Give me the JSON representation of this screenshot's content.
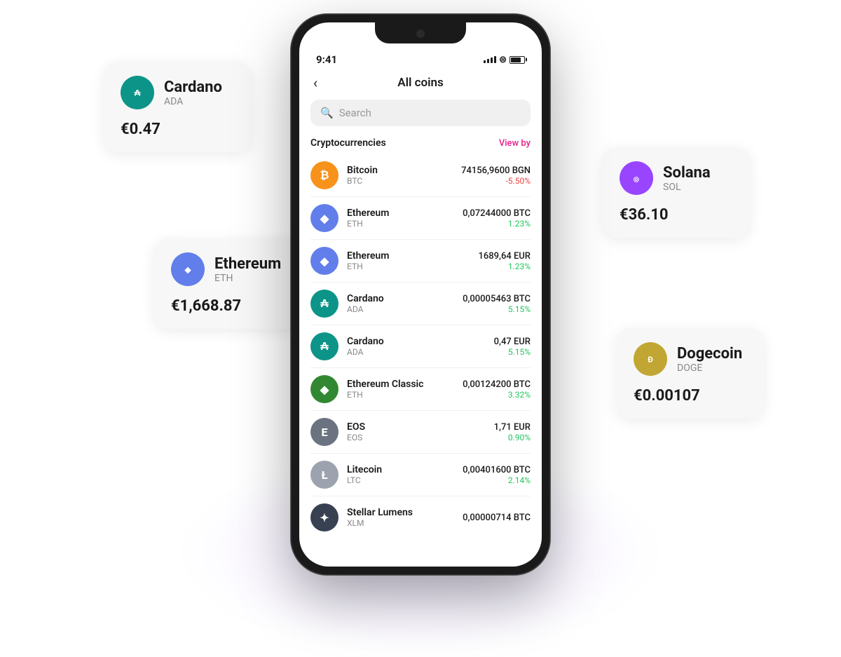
{
  "scene": {
    "background": "#ffffff"
  },
  "cards": {
    "cardano": {
      "name": "Cardano",
      "symbol": "ADA",
      "price": "€0.47"
    },
    "ethereum": {
      "name": "Ethereum",
      "symbol": "ETH",
      "price": "€1,668.87"
    },
    "solana": {
      "name": "Solana",
      "symbol": "SOL",
      "price": "€36.10"
    },
    "dogecoin": {
      "name": "Dogecoin",
      "symbol": "DOGE",
      "price": "€0.00107"
    }
  },
  "phone": {
    "status": {
      "time": "9:41"
    },
    "header": {
      "title": "All coins",
      "back": "‹"
    },
    "search": {
      "placeholder": "Search"
    },
    "section": {
      "title": "Cryptocurrencies",
      "view_by": "View by"
    },
    "coins": [
      {
        "name": "Bitcoin",
        "symbol": "BTC",
        "amount": "74156,9600 BGN",
        "change": "-5.50%",
        "positive": false,
        "iconClass": "icon-btc",
        "iconText": "₿"
      },
      {
        "name": "Ethereum",
        "symbol": "ETH",
        "amount": "0,07244000 BTC",
        "change": "1.23%",
        "positive": true,
        "iconClass": "icon-eth",
        "iconText": "◆"
      },
      {
        "name": "Ethereum",
        "symbol": "ETH",
        "amount": "1689,64 EUR",
        "change": "1.23%",
        "positive": true,
        "iconClass": "icon-eth",
        "iconText": "◆"
      },
      {
        "name": "Cardano",
        "symbol": "ADA",
        "amount": "0,00005463 BTC",
        "change": "5.15%",
        "positive": true,
        "iconClass": "icon-ada",
        "iconText": "⊕"
      },
      {
        "name": "Cardano",
        "symbol": "ADA",
        "amount": "0,47 EUR",
        "change": "5.15%",
        "positive": true,
        "iconClass": "icon-ada",
        "iconText": "⊕"
      },
      {
        "name": "Ethereum Classic",
        "symbol": "ETH",
        "amount": "0,00124200 BTC",
        "change": "3.32%",
        "positive": true,
        "iconClass": "icon-etc",
        "iconText": "◆"
      },
      {
        "name": "EOS",
        "symbol": "EOS",
        "amount": "1,71 EUR",
        "change": "0.90%",
        "positive": true,
        "iconClass": "icon-eos",
        "iconText": "⬡"
      },
      {
        "name": "Litecoin",
        "symbol": "LTC",
        "amount": "0,00401600 BTC",
        "change": "2.14%",
        "positive": true,
        "iconClass": "icon-ltc",
        "iconText": "Ł"
      },
      {
        "name": "Stellar Lumens",
        "symbol": "XLM",
        "amount": "0,00000714 BTC",
        "change": "",
        "positive": true,
        "iconClass": "icon-xlm",
        "iconText": "✦"
      }
    ]
  }
}
